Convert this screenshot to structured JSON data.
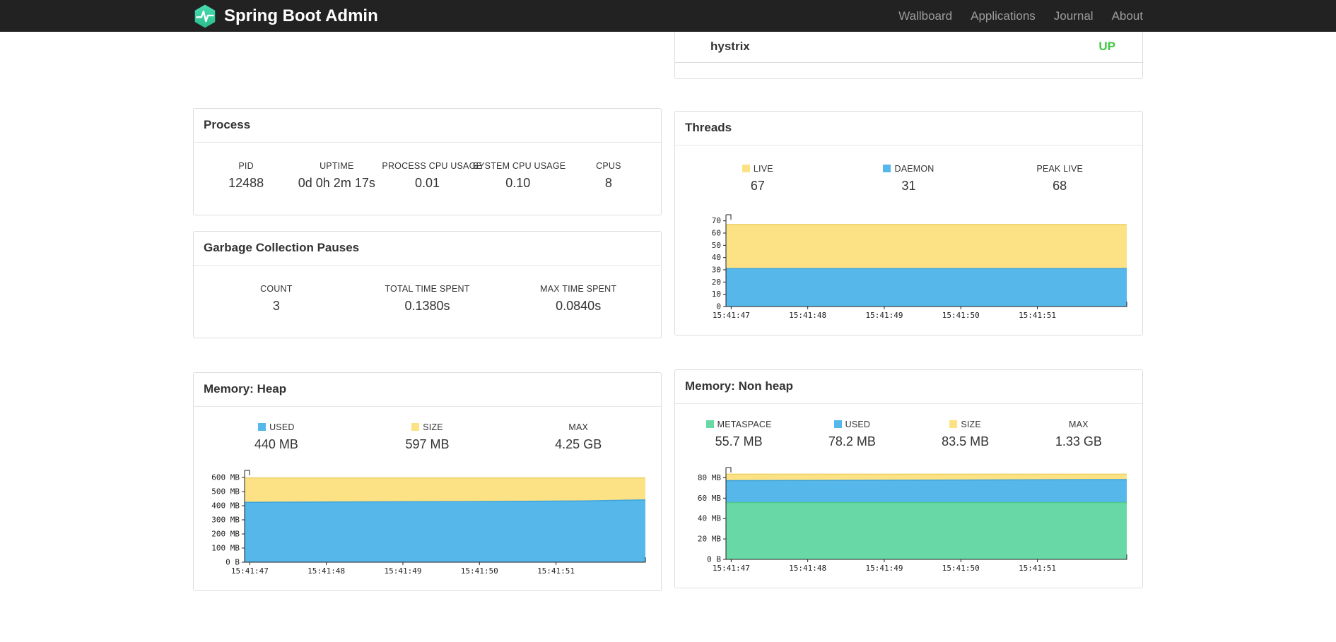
{
  "navbar": {
    "brand": "Spring Boot Admin",
    "links": [
      "Wallboard",
      "Applications",
      "Journal",
      "About"
    ]
  },
  "applications_panel": {
    "rows": [
      {
        "name": "hystrix",
        "status": "UP",
        "status_color": "#3fc93f"
      }
    ]
  },
  "process_panel": {
    "title": "Process",
    "stats": [
      {
        "label": "PID",
        "value": "12488"
      },
      {
        "label": "UPTIME",
        "value": "0d 0h 2m 17s"
      },
      {
        "label": "PROCESS CPU USAGE",
        "value": "0.01"
      },
      {
        "label": "SYSTEM CPU USAGE",
        "value": "0.10"
      },
      {
        "label": "CPUS",
        "value": "8"
      }
    ]
  },
  "gc_panel": {
    "title": "Garbage Collection Pauses",
    "stats": [
      {
        "label": "COUNT",
        "value": "3"
      },
      {
        "label": "TOTAL TIME SPENT",
        "value": "0.1380s"
      },
      {
        "label": "MAX TIME SPENT",
        "value": "0.0840s"
      }
    ]
  },
  "threads_panel": {
    "title": "Threads",
    "stats": [
      {
        "label": "LIVE",
        "value": "67",
        "color": "#fce284"
      },
      {
        "label": "DAEMON",
        "value": "31",
        "color": "#55b7ea"
      },
      {
        "label": "PEAK LIVE",
        "value": "68"
      }
    ]
  },
  "heap_panel": {
    "title": "Memory: Heap",
    "stats": [
      {
        "label": "USED",
        "value": "440 MB",
        "color": "#55b7ea"
      },
      {
        "label": "SIZE",
        "value": "597 MB",
        "color": "#fce284"
      },
      {
        "label": "MAX",
        "value": "4.25 GB"
      }
    ]
  },
  "nonheap_panel": {
    "title": "Memory: Non heap",
    "stats": [
      {
        "label": "METASPACE",
        "value": "55.7 MB",
        "color": "#68d9a6"
      },
      {
        "label": "USED",
        "value": "78.2 MB",
        "color": "#55b7ea"
      },
      {
        "label": "SIZE",
        "value": "83.5 MB",
        "color": "#fce284"
      },
      {
        "label": "MAX",
        "value": "1.33 GB"
      }
    ]
  },
  "chart_data": [
    {
      "id": "threads",
      "type": "area",
      "title": "Threads",
      "ylim": [
        0,
        75
      ],
      "grid": false,
      "legend_position": "top",
      "y_ticks": [
        {
          "v": 0,
          "label": "0"
        },
        {
          "v": 10,
          "label": "10"
        },
        {
          "v": 20,
          "label": "20"
        },
        {
          "v": 30,
          "label": "30"
        },
        {
          "v": 40,
          "label": "40"
        },
        {
          "v": 50,
          "label": "50"
        },
        {
          "v": 60,
          "label": "60"
        },
        {
          "v": 70,
          "label": "70"
        }
      ],
      "x_ticks": [
        {
          "f": 0.013,
          "label": "15:41:47"
        },
        {
          "f": 0.204,
          "label": "15:41:48"
        },
        {
          "f": 0.395,
          "label": "15:41:49"
        },
        {
          "f": 0.586,
          "label": "15:41:50"
        },
        {
          "f": 0.777,
          "label": "15:41:51"
        }
      ],
      "series": [
        {
          "name": "LIVE",
          "fill": "#fce284",
          "stroke": "#edd063",
          "points": [
            [
              0,
              67
            ],
            [
              1,
              67
            ]
          ]
        },
        {
          "name": "DAEMON",
          "fill": "#55b7ea",
          "stroke": "#3fa4db",
          "points": [
            [
              0,
              31
            ],
            [
              1,
              31
            ]
          ]
        }
      ]
    },
    {
      "id": "memory-heap",
      "type": "area",
      "title": "Memory: Heap",
      "ylim": [
        0,
        650
      ],
      "grid": false,
      "legend_position": "top",
      "y_ticks": [
        {
          "v": 0,
          "label": "0 B"
        },
        {
          "v": 100,
          "label": "100 MB"
        },
        {
          "v": 200,
          "label": "200 MB"
        },
        {
          "v": 300,
          "label": "300 MB"
        },
        {
          "v": 400,
          "label": "400 MB"
        },
        {
          "v": 500,
          "label": "500 MB"
        },
        {
          "v": 600,
          "label": "600 MB"
        }
      ],
      "x_ticks": [
        {
          "f": 0.013,
          "label": "15:41:47"
        },
        {
          "f": 0.204,
          "label": "15:41:48"
        },
        {
          "f": 0.395,
          "label": "15:41:49"
        },
        {
          "f": 0.586,
          "label": "15:41:50"
        },
        {
          "f": 0.777,
          "label": "15:41:51"
        }
      ],
      "series": [
        {
          "name": "SIZE",
          "fill": "#fce284",
          "stroke": "#edd063",
          "points": [
            [
              0,
              597
            ],
            [
              1,
              597
            ]
          ]
        },
        {
          "name": "USED",
          "fill": "#55b7ea",
          "stroke": "#3fa4db",
          "points": [
            [
              0,
              424
            ],
            [
              0.55,
              429
            ],
            [
              0.85,
              434
            ],
            [
              1,
              441
            ]
          ]
        }
      ]
    },
    {
      "id": "memory-nonheap",
      "type": "area",
      "title": "Memory: Non heap",
      "ylim": [
        0,
        90
      ],
      "grid": false,
      "legend_position": "top",
      "y_ticks": [
        {
          "v": 0,
          "label": "0 B"
        },
        {
          "v": 20,
          "label": "20 MB"
        },
        {
          "v": 40,
          "label": "40 MB"
        },
        {
          "v": 60,
          "label": "60 MB"
        },
        {
          "v": 80,
          "label": "80 MB"
        }
      ],
      "x_ticks": [
        {
          "f": 0.013,
          "label": "15:41:47"
        },
        {
          "f": 0.204,
          "label": "15:41:48"
        },
        {
          "f": 0.395,
          "label": "15:41:49"
        },
        {
          "f": 0.586,
          "label": "15:41:50"
        },
        {
          "f": 0.777,
          "label": "15:41:51"
        }
      ],
      "series": [
        {
          "name": "SIZE",
          "fill": "#fce284",
          "stroke": "#edd063",
          "points": [
            [
              0,
              83.5
            ],
            [
              1,
              83.5
            ]
          ]
        },
        {
          "name": "USED",
          "fill": "#55b7ea",
          "stroke": "#3fa4db",
          "points": [
            [
              0,
              77.2
            ],
            [
              0.6,
              77.8
            ],
            [
              1,
              78.2
            ]
          ]
        },
        {
          "name": "METASPACE",
          "fill": "#68d9a6",
          "stroke": "#4fc78f",
          "points": [
            [
              0,
              55.7
            ],
            [
              1,
              55.7
            ]
          ]
        }
      ]
    }
  ]
}
